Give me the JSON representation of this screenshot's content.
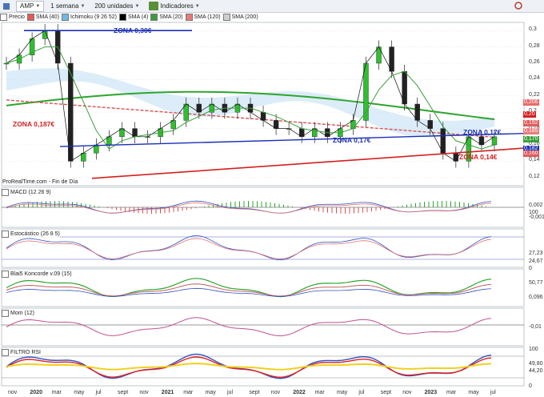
{
  "toolbar": {
    "symbol": "AMP",
    "period": "1 semana",
    "units": "200 unidades",
    "indicators": "Indicadores"
  },
  "legend": [
    {
      "label": "Precio",
      "color": "#ffffff"
    },
    {
      "label": "SMA (40)",
      "color": "#e35a5a"
    },
    {
      "label": "Ichimoku (9 26 52)",
      "color": "#70b8e8"
    },
    {
      "label": "SMA (4)",
      "color": "#000000"
    },
    {
      "label": "SMA (20)",
      "color": "#3b9e3b"
    },
    {
      "label": "SMA (120)",
      "color": "#e87a7a"
    },
    {
      "label": "SMA (200)",
      "color": "#cfcfcf"
    }
  ],
  "zones": [
    {
      "label": "ZONA 0,30€",
      "color": "#1a2fb5"
    },
    {
      "label": "ZONA 0,187€",
      "color": "#d42020"
    },
    {
      "label": "ZONA 0,17€",
      "color": "#1a2fb5"
    },
    {
      "label": "ZONA 0,17€",
      "color": "#1a2fb5"
    },
    {
      "label": "ZONA 0,14€",
      "color": "#d42020"
    }
  ],
  "watermark": "ProRealTime.com - Fin de Día",
  "panels": [
    "MACD (12 26 9)",
    "Estocástico (26 8 5)",
    "Blai5 Koncorde v.09 (15)",
    "Mom (12)",
    "FILTRO RSI"
  ],
  "chart_data": {
    "type": "line",
    "title": "AMP",
    "x": [
      "2019-11",
      "2019-12",
      "2020-01",
      "2020-02",
      "2020-03",
      "2020-04",
      "2020-05",
      "2020-06",
      "2020-07",
      "2020-08",
      "2020-09",
      "2020-10",
      "2020-11",
      "2020-12",
      "2021-01",
      "2021-02",
      "2021-03",
      "2021-04",
      "2021-05",
      "2021-06",
      "2021-07",
      "2021-08",
      "2021-09",
      "2021-10",
      "2021-11",
      "2021-12",
      "2022-01",
      "2022-02",
      "2022-03",
      "2022-04",
      "2022-05",
      "2022-06",
      "2022-07",
      "2022-08",
      "2022-09",
      "2022-10",
      "2022-11",
      "2022-12",
      "2023-01"
    ],
    "series": [
      {
        "name": "Precio",
        "values": [
          0.26,
          0.27,
          0.29,
          0.3,
          0.26,
          0.14,
          0.15,
          0.16,
          0.17,
          0.18,
          0.17,
          0.17,
          0.18,
          0.19,
          0.21,
          0.2,
          0.21,
          0.2,
          0.21,
          0.2,
          0.19,
          0.18,
          0.18,
          0.17,
          0.18,
          0.17,
          0.18,
          0.19,
          0.26,
          0.28,
          0.25,
          0.21,
          0.19,
          0.18,
          0.15,
          0.14,
          0.17,
          0.16,
          0.17
        ]
      }
    ],
    "y_ticks": [
      "0,3",
      "0,28",
      "0,26",
      "0,24",
      "0,22",
      "0,2",
      "0,18",
      "0,16",
      "0,14",
      "0,12"
    ],
    "badges": [
      {
        "text": "0,206",
        "color": "#e86a6a"
      },
      {
        "text": "0,20",
        "color": "#d42020"
      },
      {
        "text": "0,192",
        "color": "#e35a5a"
      },
      {
        "text": "0,185",
        "color": "#e87a7a"
      },
      {
        "text": "0,170",
        "color": "#3b9e3b"
      },
      {
        "text": "0,182",
        "color": "#1a2fb5"
      },
      {
        "text": "0,160",
        "color": "#e35a5a"
      }
    ],
    "x_labels": [
      "nov",
      "2020",
      "mar",
      "may",
      "jul",
      "sept",
      "nov",
      "2021",
      "mar",
      "may",
      "jul",
      "sept",
      "nov",
      "2022",
      "mar",
      "may",
      "jul",
      "sept",
      "nov",
      "2023",
      "mar",
      "may",
      "jul"
    ],
    "subpanel_ticks": {
      "macd": [
        "0,002",
        "-0,001"
      ],
      "estocastico": [
        "100",
        "27,23",
        "24,67",
        "0"
      ],
      "koncorde": [
        "50,77",
        "0,096"
      ],
      "mom": [
        "-0,01"
      ],
      "rsi": [
        "100",
        "49,80",
        "44,20",
        "0"
      ]
    },
    "ylim": [
      0.11,
      0.31
    ],
    "grid": true,
    "legend_position": "top-left"
  }
}
